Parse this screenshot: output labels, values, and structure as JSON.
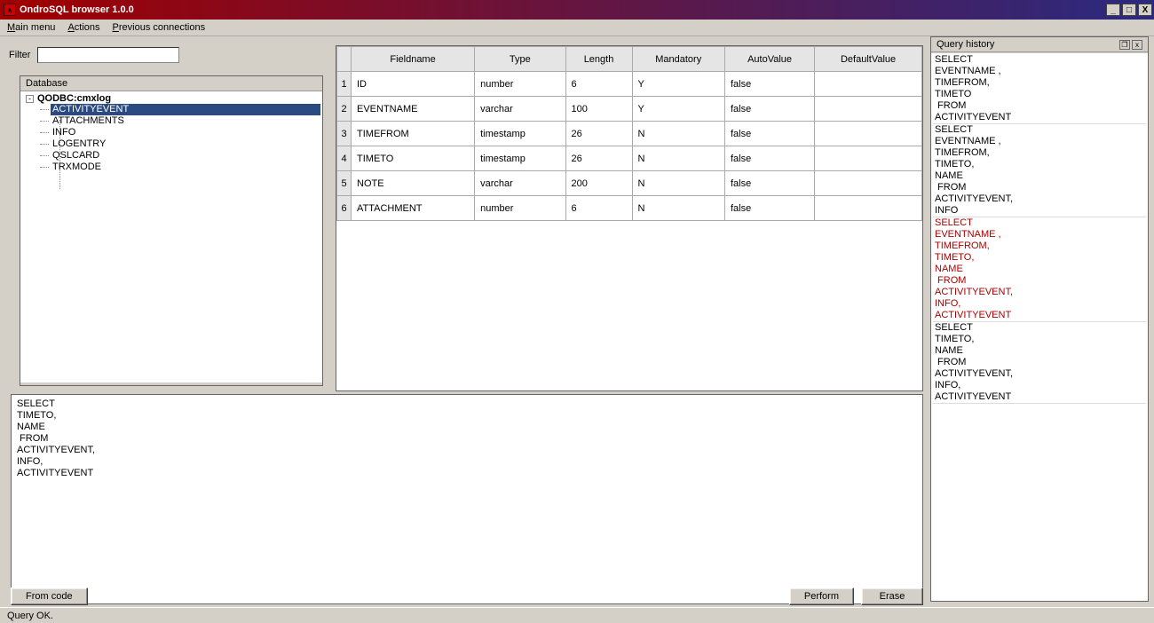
{
  "window": {
    "title": "OndroSQL browser 1.0.0"
  },
  "menu": {
    "main": "Main menu",
    "actions": "Actions",
    "prev": "Previous connections"
  },
  "filter": {
    "label": "Filter",
    "value": ""
  },
  "db_panel": {
    "title": "Database",
    "root": "QODBC:cmxlog",
    "items": [
      "ACTIVITYEVENT",
      "ATTACHMENTS",
      "INFO",
      "LOGENTRY",
      "QSLCARD",
      "TRXMODE"
    ],
    "selected_index": 0
  },
  "grid": {
    "headers": [
      "Fieldname",
      "Type",
      "Length",
      "Mandatory",
      "AutoValue",
      "DefaultValue"
    ],
    "rows": [
      {
        "n": "1",
        "Fieldname": "ID",
        "Type": "number",
        "Length": "6",
        "Mandatory": "Y",
        "AutoValue": "false",
        "DefaultValue": ""
      },
      {
        "n": "2",
        "Fieldname": "EVENTNAME",
        "Type": "varchar",
        "Length": "100",
        "Mandatory": "Y",
        "AutoValue": "false",
        "DefaultValue": ""
      },
      {
        "n": "3",
        "Fieldname": "TIMEFROM",
        "Type": "timestamp",
        "Length": "26",
        "Mandatory": "N",
        "AutoValue": "false",
        "DefaultValue": ""
      },
      {
        "n": "4",
        "Fieldname": "TIMETO",
        "Type": "timestamp",
        "Length": "26",
        "Mandatory": "N",
        "AutoValue": "false",
        "DefaultValue": ""
      },
      {
        "n": "5",
        "Fieldname": "NOTE",
        "Type": "varchar",
        "Length": "200",
        "Mandatory": "N",
        "AutoValue": "false",
        "DefaultValue": ""
      },
      {
        "n": "6",
        "Fieldname": "ATTACHMENT",
        "Type": "number",
        "Length": "6",
        "Mandatory": "N",
        "AutoValue": "false",
        "DefaultValue": ""
      }
    ]
  },
  "editor": {
    "text": "SELECT\nTIMETO,\nNAME\n FROM\nACTIVITYEVENT,\nINFO,\nACTIVITYEVENT"
  },
  "buttons": {
    "fromcode": "From code",
    "perform": "Perform",
    "erase": "Erase"
  },
  "status": {
    "text": "Query OK."
  },
  "history": {
    "title": "Query history",
    "entries": [
      {
        "text": "SELECT\nEVENTNAME ,\nTIMEFROM,\nTIMETO\n FROM\nACTIVITYEVENT",
        "error": false
      },
      {
        "text": "SELECT\nEVENTNAME ,\nTIMEFROM,\nTIMETO,\nNAME\n FROM\nACTIVITYEVENT,\nINFO",
        "error": false
      },
      {
        "text": "SELECT\nEVENTNAME ,\nTIMEFROM,\nTIMETO,\nNAME\n FROM\nACTIVITYEVENT,\nINFO,\nACTIVITYEVENT",
        "error": true
      },
      {
        "text": "SELECT\nTIMETO,\nNAME\n FROM\nACTIVITYEVENT,\nINFO,\nACTIVITYEVENT",
        "error": false
      }
    ]
  }
}
